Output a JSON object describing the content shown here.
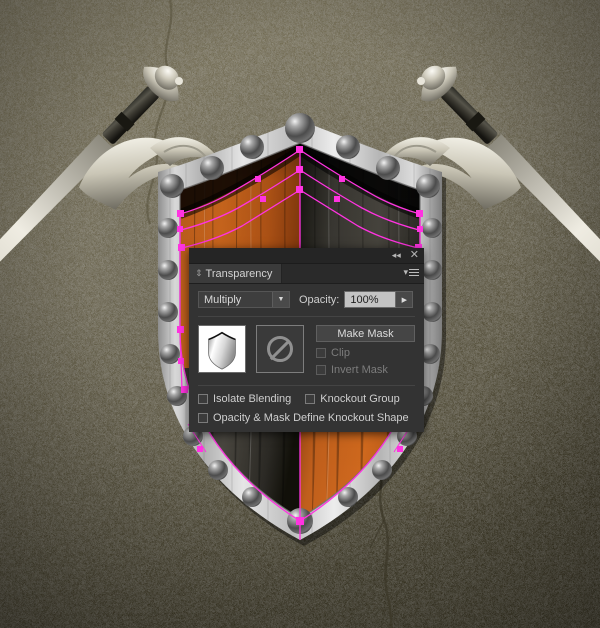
{
  "artwork": {
    "description": "crossed-swords-and-shield-illustration",
    "background_color": "#6e6850",
    "background_color_dark": "#4a452f",
    "shield_wood_orange": "#c8601b",
    "shield_wood_dark": "#2e2c29",
    "shield_rim_metal": "#d4d4d4",
    "path_selection_color": "#ff33e0",
    "blade_metal": "#e9e6dc"
  },
  "panel": {
    "titlebar": {
      "collapse_icon": "collapse-double-arrow-left",
      "collapse_glyph": "◂◂",
      "close_icon": "close-icon",
      "close_glyph": "✕"
    },
    "tab": {
      "label": "Transparency",
      "grip_glyph": "⇕",
      "menu_icon": "panel-menu-icon",
      "menu_glyph": "▾"
    },
    "blend": {
      "mode_value": "Multiply",
      "mode_arrow": "▼",
      "opacity_label": "Opacity:",
      "opacity_value": "100%",
      "opacity_stepper_glyph": "▶"
    },
    "thumbnails": {
      "object_thumb_name": "shield-object-thumbnail",
      "mask_thumb_name": "no-mask-thumbnail"
    },
    "actions": {
      "make_mask_label": "Make Mask",
      "clip_label": "Clip",
      "clip_checked": false,
      "clip_enabled": false,
      "invert_mask_label": "Invert Mask",
      "invert_mask_checked": false,
      "invert_mask_enabled": false
    },
    "options": {
      "isolate_blending_label": "Isolate Blending",
      "isolate_blending_checked": false,
      "knockout_group_label": "Knockout Group",
      "knockout_group_checked": false,
      "opacity_mask_label": "Opacity & Mask Define Knockout Shape",
      "opacity_mask_checked": false
    }
  }
}
